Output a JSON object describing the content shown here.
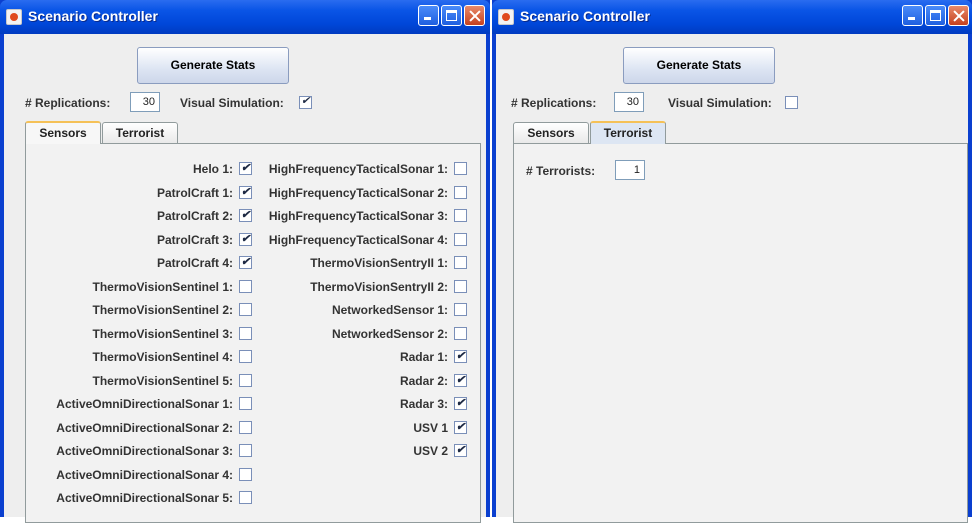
{
  "windows": [
    {
      "title": "Scenario Controller",
      "generate_label": "Generate Stats",
      "replications_label": "# Replications:",
      "replications_value": "30",
      "visual_label": "Visual Simulation:",
      "visual_checked": true,
      "tabs": [
        "Sensors",
        "Terrorist"
      ],
      "selected_tab": "Sensors",
      "left_column": [
        {
          "label": "Helo 1:",
          "checked": true
        },
        {
          "label": "PatrolCraft 1:",
          "checked": true
        },
        {
          "label": "PatrolCraft 2:",
          "checked": true
        },
        {
          "label": "PatrolCraft 3:",
          "checked": true
        },
        {
          "label": "PatrolCraft 4:",
          "checked": true
        },
        {
          "label": "ThermoVisionSentinel 1:",
          "checked": false
        },
        {
          "label": "ThermoVisionSentinel 2:",
          "checked": false
        },
        {
          "label": "ThermoVisionSentinel 3:",
          "checked": false
        },
        {
          "label": "ThermoVisionSentinel 4:",
          "checked": false
        },
        {
          "label": "ThermoVisionSentinel 5:",
          "checked": false
        },
        {
          "label": "ActiveOmniDirectionalSonar 1:",
          "checked": false
        },
        {
          "label": "ActiveOmniDirectionalSonar 2:",
          "checked": false
        },
        {
          "label": "ActiveOmniDirectionalSonar 3:",
          "checked": false
        },
        {
          "label": "ActiveOmniDirectionalSonar 4:",
          "checked": false
        },
        {
          "label": "ActiveOmniDirectionalSonar 5:",
          "checked": false
        }
      ],
      "right_column": [
        {
          "label": "HighFrequencyTacticalSonar 1:",
          "checked": false
        },
        {
          "label": "HighFrequencyTacticalSonar 2:",
          "checked": false
        },
        {
          "label": "HighFrequencyTacticalSonar 3:",
          "checked": false
        },
        {
          "label": "HighFrequencyTacticalSonar 4:",
          "checked": false
        },
        {
          "label": "ThermoVisionSentryII 1:",
          "checked": false
        },
        {
          "label": "ThermoVisionSentryII 2:",
          "checked": false
        },
        {
          "label": "NetworkedSensor 1:",
          "checked": false
        },
        {
          "label": "NetworkedSensor 2:",
          "checked": false
        },
        {
          "label": "Radar 1:",
          "checked": true
        },
        {
          "label": "Radar 2:",
          "checked": true
        },
        {
          "label": "Radar 3:",
          "checked": true
        },
        {
          "label": "USV 1",
          "checked": true
        },
        {
          "label": "USV 2",
          "checked": true
        }
      ]
    },
    {
      "title": "Scenario Controller",
      "generate_label": "Generate Stats",
      "replications_label": "# Replications:",
      "replications_value": "30",
      "visual_label": "Visual Simulation:",
      "visual_checked": false,
      "tabs": [
        "Sensors",
        "Terrorist"
      ],
      "selected_tab": "Terrorist",
      "terrorists_label": "# Terrorists:",
      "terrorists_value": "1"
    }
  ],
  "icons": [
    "java-cup-icon",
    "minimize-icon",
    "maximize-icon",
    "close-icon",
    "checkmark-icon"
  ],
  "colors": {
    "titlebar": "#0a55e6",
    "window_bg": "#eeeeee",
    "tab_highlight": "#f5c157",
    "close_button": "#c5401e"
  }
}
